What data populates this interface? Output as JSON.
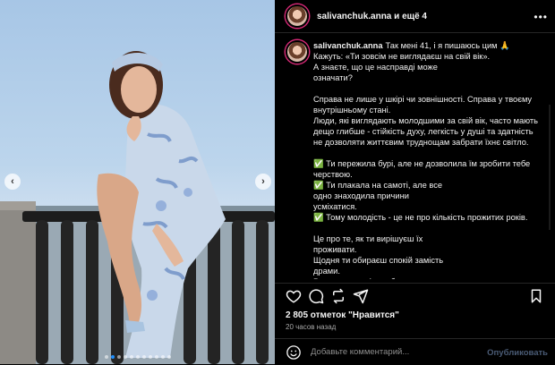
{
  "header": {
    "title": "salivanchuk.anna и ещё 4",
    "more_icon": "more-horizontal-icon"
  },
  "caption": {
    "author": "salivanchuk.anna",
    "first_line": "Так мені 41, і я пишаюсь цим 🙏",
    "body": "Кажуть: «Ти зовсім не виглядаєш на свій вік».\nА знаєте, що це насправді може\nозначати?\n\nСправа не лише у шкірі чи зовнішності. Справа у твоєму внутрішньому стані.\nЛюди, які виглядають молодшими за свій вік, часто мають дещо глибше - стійкість духу, легкість у душі та здатність не дозволяти життєвим труднощам забрати їхнє світло.\n\n✅ Ти пережила бурі, але не дозволила їм зробити тебе черствою.\n✅ Ти плакала на самоті, але все\nодно знаходила причини\nусміхатися.\n✅ Тому молодість - це не про кількість прожитих років.\n\nЦе про те, як ти вирішуєш їх\nпроживати.\nЩодня ти обираєш спокій замість\nдрами.\nРозвиток - замість образ.\nЗ... ...сть ...осте..."
  },
  "actions": {
    "like": "heart-icon",
    "comment": "comment-icon",
    "share": "share-icon",
    "save": "bookmark-icon"
  },
  "likes": "2 805 отметок \"Нравится\"",
  "time": "20 часов назад",
  "comment": {
    "placeholder": "Добавьте комментарий...",
    "publish_label": "Опубликовать",
    "emoji_icon": "emoji-icon"
  },
  "carousel": {
    "prev_icon": "chevron-left-icon",
    "next_icon": "chevron-right-icon",
    "slide_count": 11,
    "active_index": 1
  },
  "colors": {
    "story_ring": "#d62976",
    "carousel_dot_active": "#1e90ff"
  }
}
